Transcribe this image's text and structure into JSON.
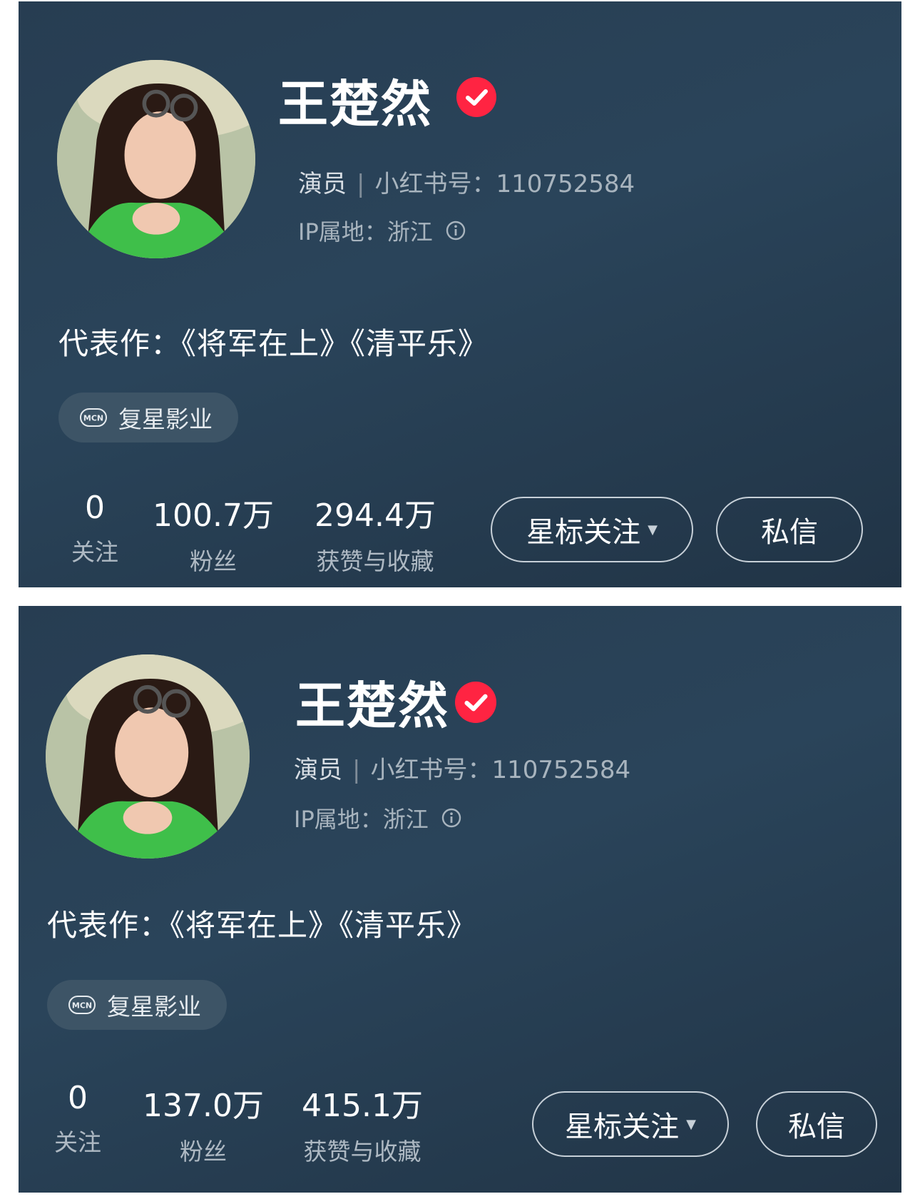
{
  "profiles": [
    {
      "name": "王楚然",
      "role": "演员",
      "id_label": "小红书号：",
      "id_value": "110752584",
      "ip_label": "IP属地：",
      "ip_value": "浙江",
      "bio": "代表作：《将军在上》《清平乐》",
      "mcn_icon_text": "MCN",
      "mcn_name": "复星影业",
      "stats": [
        {
          "value": "0",
          "label": "关注"
        },
        {
          "value": "100.7万",
          "label": "粉丝"
        },
        {
          "value": "294.4万",
          "label": "获赞与收藏"
        }
      ],
      "follow_button": "星标关注",
      "message_button": "私信"
    },
    {
      "name": "王楚然",
      "role": "演员",
      "id_label": "小红书号：",
      "id_value": "110752584",
      "ip_label": "IP属地：",
      "ip_value": "浙江",
      "bio": "代表作：《将军在上》《清平乐》",
      "mcn_icon_text": "MCN",
      "mcn_name": "复星影业",
      "stats": [
        {
          "value": "0",
          "label": "关注"
        },
        {
          "value": "137.0万",
          "label": "粉丝"
        },
        {
          "value": "415.1万",
          "label": "获赞与收藏"
        }
      ],
      "follow_button": "星标关注",
      "message_button": "私信"
    }
  ],
  "colors": {
    "background": "#273d52",
    "verified_badge": "#ff2442",
    "mcn_chip": "#3d5466"
  },
  "icons": {
    "verified": "verified-check-icon",
    "info": "info-icon",
    "mcn": "mcn-icon",
    "caret": "caret-down-icon"
  }
}
